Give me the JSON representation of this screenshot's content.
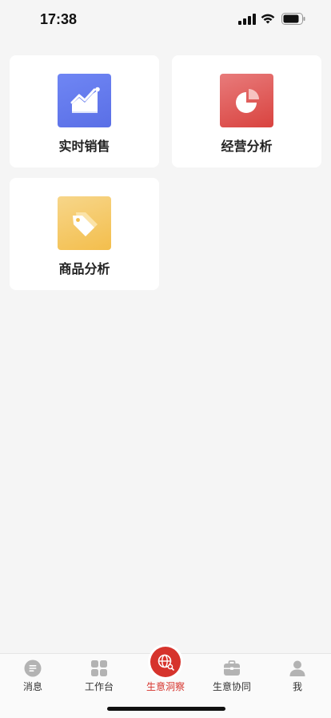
{
  "status_bar": {
    "time": "17:38"
  },
  "cards": [
    {
      "label": "实时销售",
      "icon": "trend-chart-icon"
    },
    {
      "label": "经营分析",
      "icon": "pie-chart-icon"
    },
    {
      "label": "商品分析",
      "icon": "price-tag-icon"
    }
  ],
  "tabs": [
    {
      "label": "消息",
      "icon": "message-icon"
    },
    {
      "label": "工作台",
      "icon": "grid-icon"
    },
    {
      "label": "生意洞察",
      "icon": "globe-icon",
      "active": true
    },
    {
      "label": "生意协同",
      "icon": "briefcase-icon"
    },
    {
      "label": "我",
      "icon": "user-icon"
    }
  ],
  "colors": {
    "accent": "#d6332c",
    "background": "#f5f5f5",
    "card": "#ffffff"
  }
}
